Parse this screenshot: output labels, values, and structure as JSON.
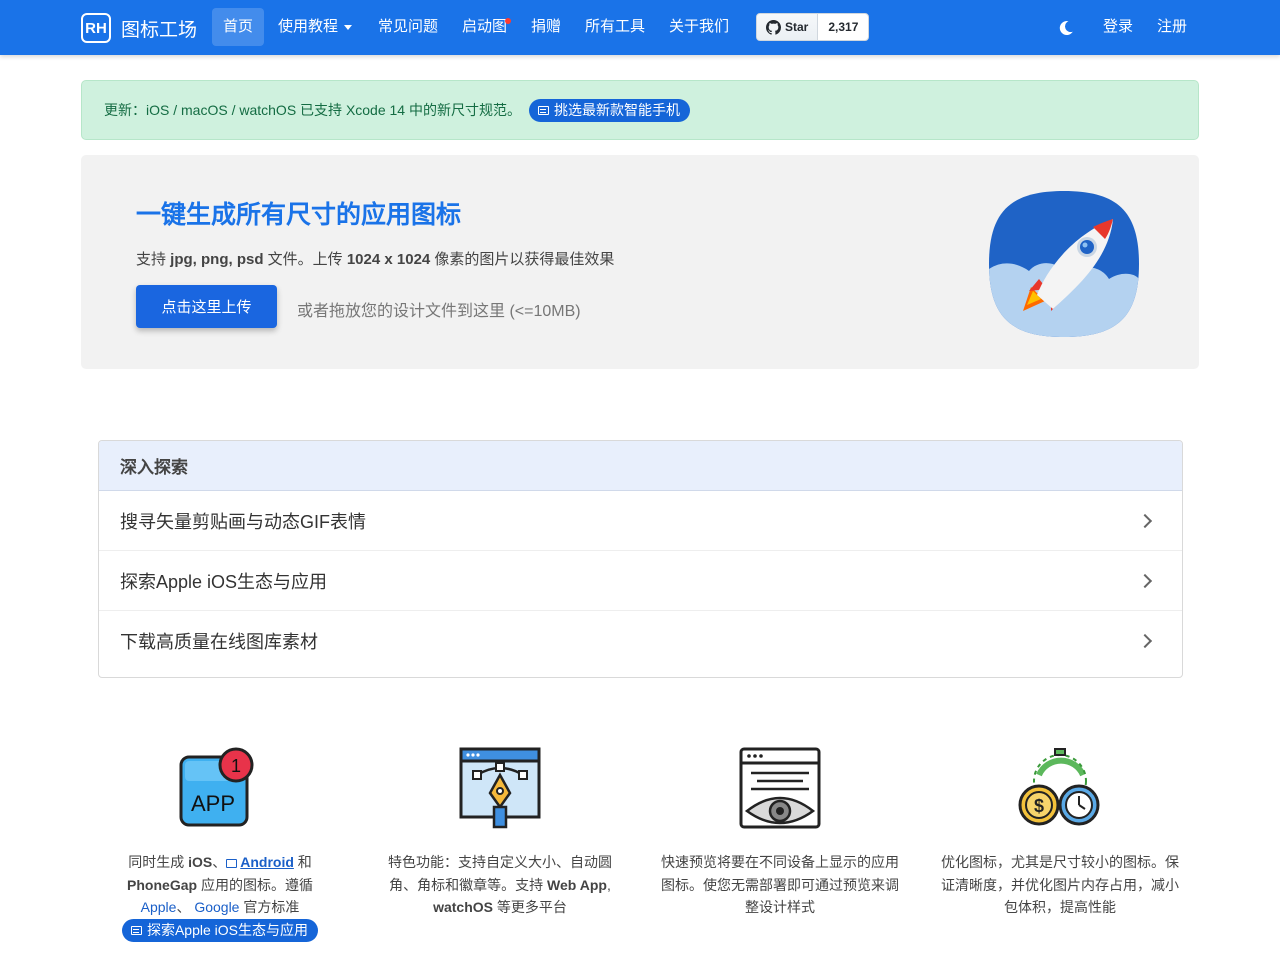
{
  "navbar": {
    "logo_text": "RH",
    "brand": "图标工场",
    "items": [
      {
        "label": "首页"
      },
      {
        "label": "使用教程"
      },
      {
        "label": "常见问题"
      },
      {
        "label": "启动图"
      },
      {
        "label": "捐赠"
      },
      {
        "label": "所有工具"
      },
      {
        "label": "关于我们"
      }
    ],
    "github": {
      "star_label": "Star",
      "count": "2,317"
    },
    "login": "登录",
    "register": "注册",
    "accent": "#1a73e8"
  },
  "alert": {
    "prefix": "更新：",
    "platforms": "iOS / macOS / watchOS",
    "middle": " 已支持 ",
    "xcode": "Xcode 14",
    "suffix": " 中的新尺寸规范。",
    "pill_label": "挑选最新款智能手机"
  },
  "hero": {
    "title": "一键生成所有尺寸的应用图标",
    "desc_prefix": "支持 ",
    "formats": "jpg, png, psd",
    "desc_mid": " 文件。上传 ",
    "size": "1024 x 1024",
    "desc_suffix": " 像素的图片以获得最佳效果",
    "upload_label": "点击这里上传",
    "drop_hint": "或者拖放您的设计文件到这里 (<=10MB)"
  },
  "explore": {
    "title": "深入探索",
    "rows": [
      {
        "label": "搜寻矢量剪贴画与动态GIF表情"
      },
      {
        "label": "探索Apple iOS生态与应用"
      },
      {
        "label": "下载高质量在线图库素材"
      }
    ]
  },
  "features": [
    {
      "icon": "app-badge-icon",
      "badge": "1",
      "app_text": "APP",
      "t1": "同时生成 ",
      "ios": "iOS",
      "t2": "、",
      "android": "Android",
      "t3": " 和",
      "phonegap": "PhoneGap",
      "t4": " 应用的图标。遵循",
      "apple": "Apple",
      "t5": "、 ",
      "google": "Google",
      "t6": " 官方标准",
      "pill_label": "探索Apple iOS生态与应用"
    },
    {
      "icon": "pen-tool-icon",
      "t1": "特色功能：支持自定义大小、自动圆角、角标和徽章等。支持 ",
      "webapp": "Web App",
      "t2": ",",
      "watchos": "watchOS",
      "t3": " 等更多平台"
    },
    {
      "icon": "eye-preview-icon",
      "text": "快速预览将要在不同设备上显示的应用图标。使您无需部署即可通过预览来调整设计样式"
    },
    {
      "icon": "optimize-coins-icon",
      "text": "优化图标，尤其是尺寸较小的图标。保证清晰度，并优化图片内存占用，减小包体积，提高性能"
    }
  ]
}
